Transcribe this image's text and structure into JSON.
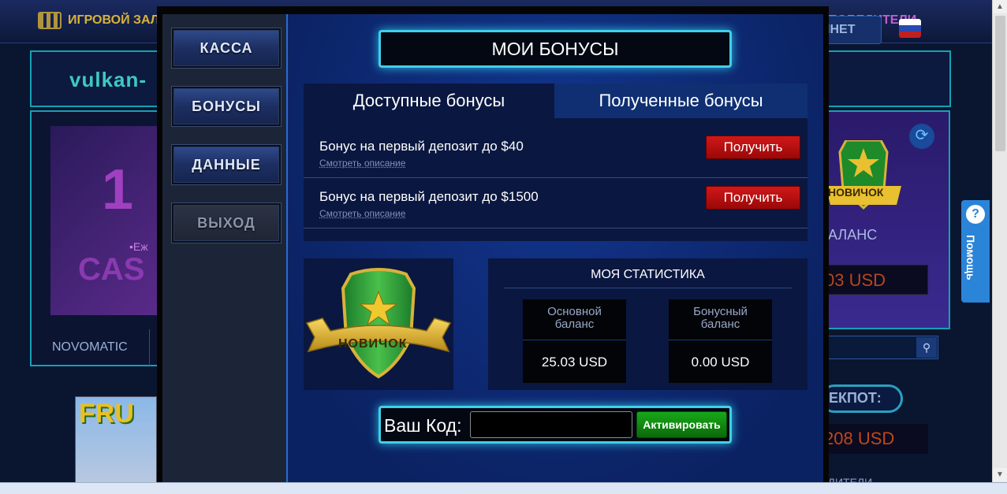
{
  "background": {
    "topbar": {
      "hall": "ИГРОВОЙ ЗАЛ",
      "winners": "ПОБЕДИТЕЛИ"
    },
    "logo": "vulkan-",
    "cabinet": "ИНЕТ",
    "banner": {
      "num": "1",
      "subtitle": "•Еж",
      "brand": "CAS"
    },
    "provider": "NOVOMATIC",
    "novice": "НОВИЧОК",
    "balance_label": "АЛАНС",
    "balance_value": "03 USD",
    "jackpot_label": "ЕКПОТ:",
    "jackpot_value": "208 USD",
    "fruit_text": "FRU",
    "winners_bottom": "ПОБЕДИТЕЛИ"
  },
  "help": {
    "label": "Помощь"
  },
  "sidebar": {
    "items": [
      {
        "label": "КАССА"
      },
      {
        "label": "БОНУСЫ"
      },
      {
        "label": "ДАННЫЕ"
      },
      {
        "label": "ВЫХОД"
      }
    ]
  },
  "modal": {
    "title": "МОИ БОНУСЫ",
    "tabs": [
      {
        "label": "Доступные бонусы",
        "active": true
      },
      {
        "label": "Полученные бонусы",
        "active": false
      }
    ],
    "bonuses": [
      {
        "name": "Бонус на первый депозит до $40",
        "desc": "Смотреть описание",
        "button": "Получить"
      },
      {
        "name": "Бонус на первый депозит до $1500",
        "desc": "Смотреть описание",
        "button": "Получить"
      }
    ],
    "badge": {
      "label": "НОВИЧОК"
    },
    "stats": {
      "title": "МОЯ СТАТИСТИКА",
      "main": {
        "label_line1": "Основной",
        "label_line2": "баланс",
        "value": "25.03 USD"
      },
      "bonus": {
        "label_line1": "Бонусный",
        "label_line2": "баланс",
        "value": "0.00 USD"
      }
    },
    "code": {
      "label": "Ваш Код:",
      "value": "",
      "button": "Активировать"
    }
  },
  "colors": {
    "accent": "#40d0e8",
    "get_button": "#c01010",
    "activate_button": "#129a12"
  }
}
